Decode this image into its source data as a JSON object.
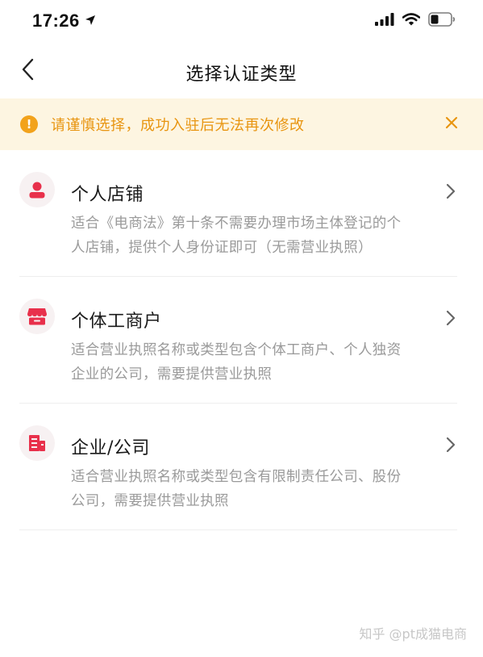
{
  "status_bar": {
    "time": "17:26",
    "icons": [
      "location-arrow-icon",
      "cellular-signal-icon",
      "wifi-icon",
      "battery-icon"
    ]
  },
  "nav": {
    "title": "选择认证类型",
    "back_icon": "chevron-left-icon"
  },
  "notice": {
    "text": "请谨慎选择，成功入驻后无法再次修改",
    "icon": "exclamation-circle-icon",
    "close_icon": "close-icon",
    "colors": {
      "background": "#fdf5e1",
      "text": "#e89511",
      "icon": "#f2a21b"
    }
  },
  "options": [
    {
      "title": "个人店铺",
      "desc_lines": [
        "适合《电商法》第十条不需要办理市场主体登记的个",
        "人店铺，提供个人身份证即可（无需营业执照）"
      ],
      "icon": "person-icon"
    },
    {
      "title": "个体工商户",
      "desc_lines": [
        "适合营业执照名称或类型包含个体工商户、个人独资",
        "企业的公司，需要提供营业执照"
      ],
      "icon": "shop-icon"
    },
    {
      "title": "企业/公司",
      "desc_lines": [
        "适合营业执照名称或类型包含有限制责任公司、股份",
        "公司，需要提供营业执照"
      ],
      "icon": "building-icon"
    }
  ],
  "accent_color": "#e8304b",
  "watermark": {
    "text": "知乎 @pt成猫电商"
  }
}
